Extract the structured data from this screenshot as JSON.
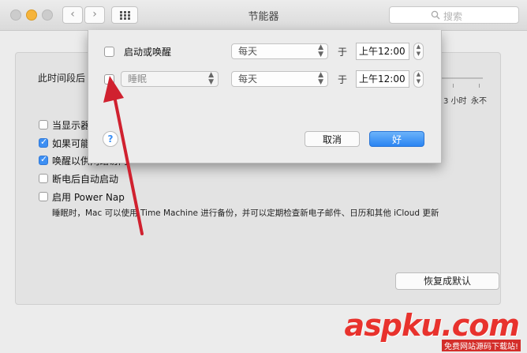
{
  "window": {
    "title": "节能器"
  },
  "toolbar": {
    "back": "‹",
    "forward": "›",
    "search_placeholder": "搜索"
  },
  "main": {
    "after_label": "此时间段后",
    "slider_ticks": [
      "3 小时",
      "永不"
    ],
    "options": [
      {
        "label": "当显示器",
        "checked": false
      },
      {
        "label": "如果可能",
        "checked": true
      },
      {
        "label": "唤醒以供网络访问",
        "checked": true
      },
      {
        "label": "断电后自动启动",
        "checked": false
      },
      {
        "label": "启用 Power Nap",
        "checked": false
      }
    ],
    "power_nap_note": "睡眠时，Mac 可以使用 Time Machine 进行备份，并可以定期检查新电子邮件、日历和其他 iCloud 更新",
    "restore_default": "恢复成默认"
  },
  "sheet": {
    "rows": [
      {
        "label": "启动或唤醒",
        "frequency": "每天",
        "at": "于",
        "time": "上午12:00",
        "checked": false
      },
      {
        "label": "睡眠",
        "frequency": "每天",
        "at": "于",
        "time": "上午12:00",
        "checked": false
      }
    ],
    "help": "?",
    "cancel": "取消",
    "ok": "好"
  },
  "watermark": {
    "brand": "aspku.com",
    "tagline": "免费网站源码下载站!"
  },
  "colors": {
    "accent": "#2a84f2",
    "arrow": "#d0212f",
    "watermark": "#e8322d"
  }
}
